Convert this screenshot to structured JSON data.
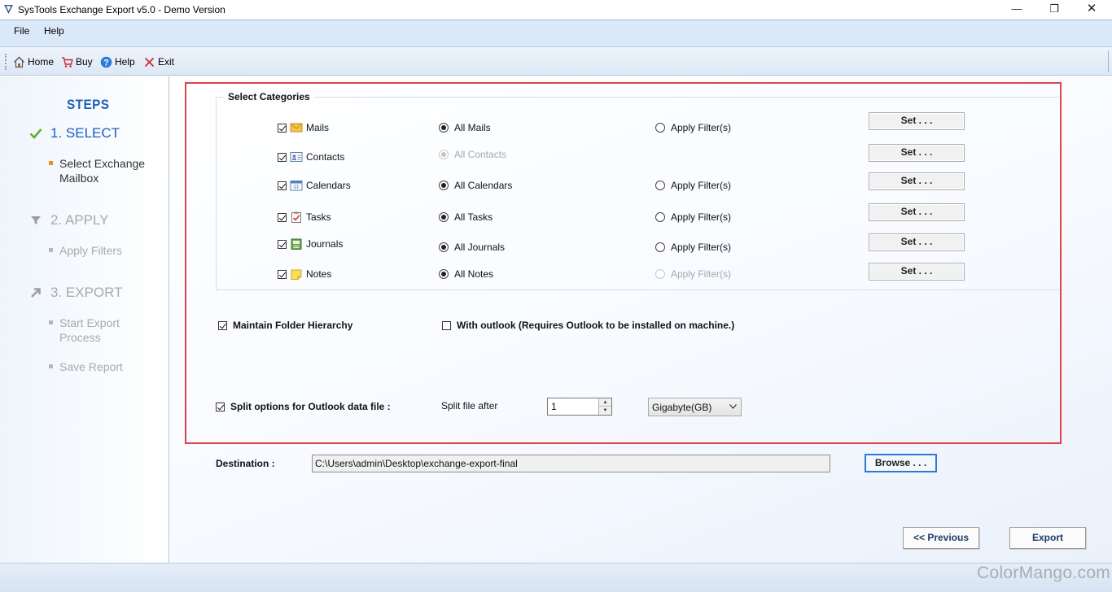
{
  "window": {
    "title": "SysTools Exchange Export v5.0 - Demo Version",
    "minimize": "—",
    "maximize": "❐",
    "close": "✕"
  },
  "menu": {
    "items": [
      "File",
      "Help"
    ]
  },
  "toolbar": {
    "items": [
      {
        "label": "Home",
        "icon": "home-icon"
      },
      {
        "label": "Buy",
        "icon": "cart-icon"
      },
      {
        "label": "Help",
        "icon": "help-icon"
      },
      {
        "label": "Exit",
        "icon": "exit-icon"
      }
    ]
  },
  "sidebar": {
    "title": "STEPS",
    "steps": [
      {
        "label": "1. SELECT",
        "icon": "check-icon",
        "state": "active",
        "sub": [
          "Select Exchange Mailbox"
        ]
      },
      {
        "label": "2. APPLY",
        "icon": "filter-icon",
        "state": "inactive",
        "sub": [
          "Apply Filters"
        ]
      },
      {
        "label": "3. EXPORT",
        "icon": "arrow-up-right-icon",
        "state": "inactive",
        "sub": [
          "Start Export Process",
          "Save Report"
        ]
      }
    ]
  },
  "categories": {
    "legend": "Select Categories",
    "set_label": "Set . . .",
    "rows": [
      {
        "name": "Mails",
        "checked": true,
        "all_label": "All Mails",
        "all_selected": true,
        "all_disabled": false,
        "filter_label": "Apply Filter(s)",
        "filter_disabled": false
      },
      {
        "name": "Contacts",
        "checked": true,
        "all_label": "All Contacts",
        "all_selected": true,
        "all_disabled": true,
        "filter_label": "",
        "filter_disabled": true
      },
      {
        "name": "Calendars",
        "checked": true,
        "all_label": "All Calendars",
        "all_selected": true,
        "all_disabled": false,
        "filter_label": "Apply Filter(s)",
        "filter_disabled": false
      },
      {
        "name": "Tasks",
        "checked": true,
        "all_label": "All Tasks",
        "all_selected": true,
        "all_disabled": false,
        "filter_label": "Apply Filter(s)",
        "filter_disabled": false
      },
      {
        "name": "Journals",
        "checked": true,
        "all_label": "All Journals",
        "all_selected": true,
        "all_disabled": false,
        "filter_label": "Apply Filter(s)",
        "filter_disabled": false
      },
      {
        "name": "Notes",
        "checked": true,
        "all_label": "All Notes",
        "all_selected": true,
        "all_disabled": false,
        "filter_label": "Apply Filter(s)",
        "filter_disabled": true
      }
    ]
  },
  "options": {
    "maintain_hierarchy": {
      "label": "Maintain Folder Hierarchy",
      "checked": true
    },
    "with_outlook": {
      "label": "With outlook (Requires Outlook to be installed on machine.)",
      "checked": false
    },
    "split": {
      "label": "Split options for Outlook data file :",
      "checked": true,
      "after_label": "Split file after",
      "value": "1",
      "unit": "Gigabyte(GB)"
    }
  },
  "destination": {
    "label": "Destination :",
    "path": "C:\\Users\\admin\\Desktop\\exchange-export-final",
    "browse_label": "Browse . . ."
  },
  "nav": {
    "previous_label": "<< Previous",
    "export_label": "Export"
  },
  "watermark": "ColorMango.com",
  "colors": {
    "accent": "#1a5fc4",
    "highlight_border": "#e0434b",
    "bullet_active": "#f58a1f"
  }
}
